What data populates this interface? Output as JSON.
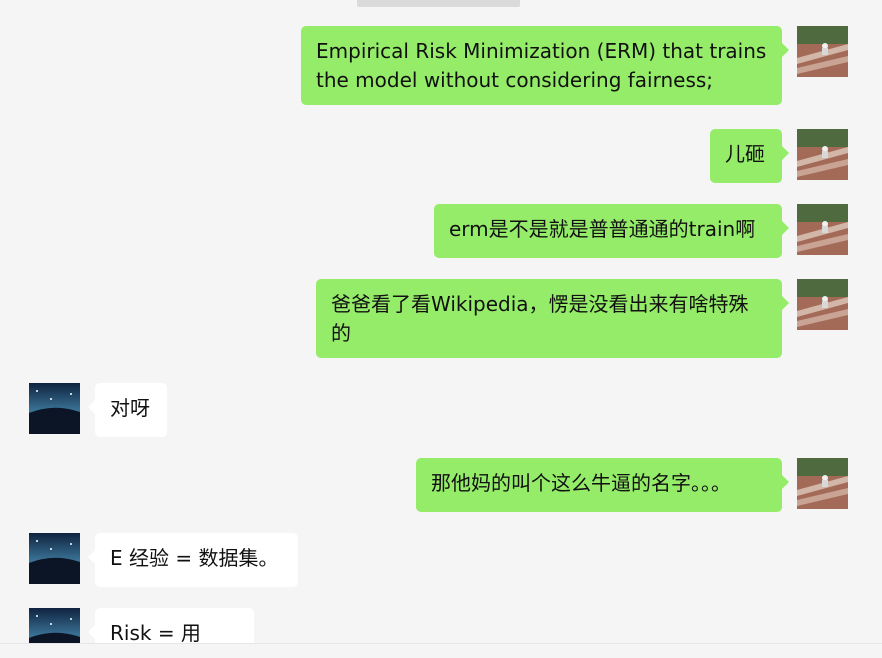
{
  "messages": [
    {
      "sender": "self",
      "text": "Empirical Risk Minimization (ERM) that trains the model without considering fairness;"
    },
    {
      "sender": "self",
      "text": "儿砸"
    },
    {
      "sender": "self",
      "text": "erm是不是就是普普通通的train啊"
    },
    {
      "sender": "self",
      "text": "爸爸看了看Wikipedia，愣是没看出来有啥特殊的"
    },
    {
      "sender": "other",
      "text": "对呀"
    },
    {
      "sender": "self",
      "text": "那他妈的叫个这么牛逼的名字。。。"
    },
    {
      "sender": "other",
      "text": "E 经验 = 数据集。"
    },
    {
      "sender": "other",
      "text": "Risk = 用loss"
    }
  ],
  "colors": {
    "background": "#f5f5f5",
    "outgoing_bubble": "#95ec69",
    "incoming_bubble": "#ffffff"
  },
  "icons": {
    "self_avatar": "avatar-outdoor-photo-icon",
    "other_avatar": "avatar-night-sky-icon"
  }
}
